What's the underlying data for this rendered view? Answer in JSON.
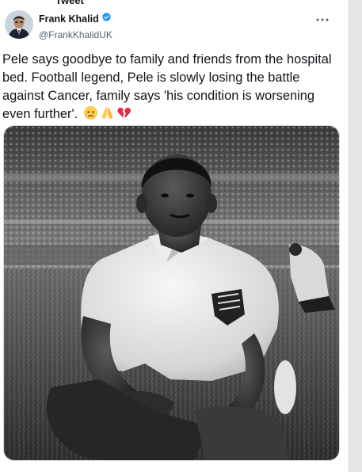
{
  "header": {
    "label": "Tweet"
  },
  "tweet": {
    "author_name": "Frank Khalid",
    "author_handle": "@FrankKhalidUK",
    "verified": true,
    "text": "Pele says goodbye to family and friends from the hospital bed. Football legend, Pele is slowly losing the battle against Cancer, family says 'his condition is worsening even further'.",
    "emojis": [
      "crying-face",
      "folded-hands",
      "broken-heart"
    ]
  },
  "colors": {
    "verified_blue": "#1d9bf0",
    "text": "#0f1419",
    "muted": "#536471"
  }
}
